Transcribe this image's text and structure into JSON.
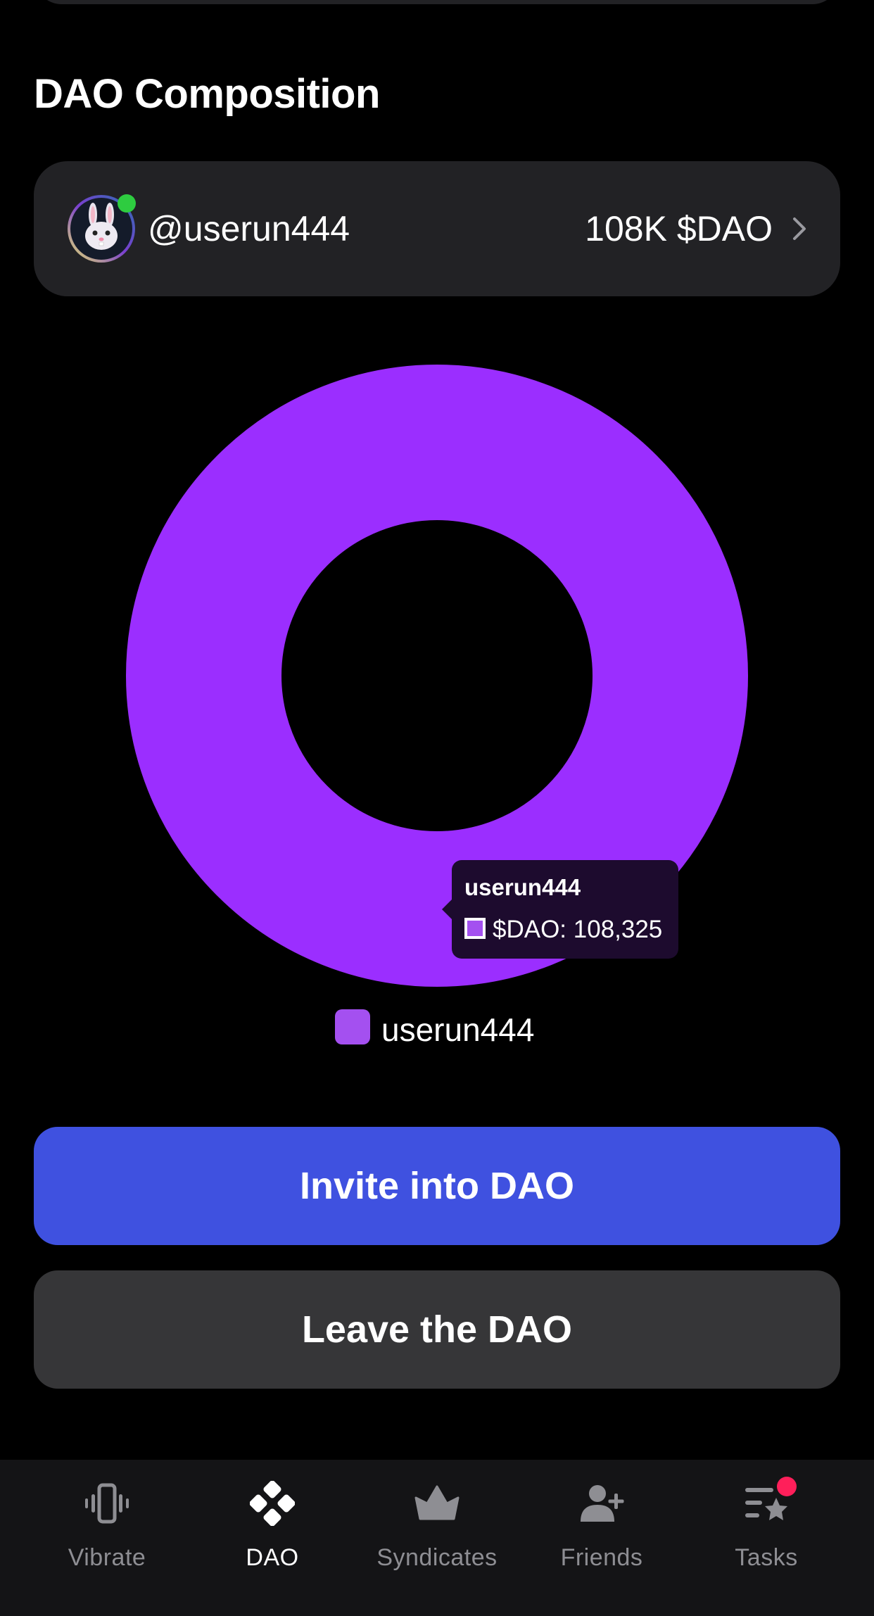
{
  "section_title": "DAO Composition",
  "member": {
    "username": "@userun444",
    "amount": "108K $DAO",
    "online": true,
    "avatar_icon": "bunny-face-icon"
  },
  "chart_data": {
    "type": "pie",
    "donut": true,
    "title": "",
    "series": [
      {
        "name": "userun444",
        "label": "$DAO",
        "value": 108325,
        "color": "#9b2eff"
      }
    ],
    "legend": {
      "placement": "bottom-center",
      "entries": [
        "userun444"
      ],
      "swatch_color": "#a450f0"
    },
    "tooltip": {
      "title": "userun444",
      "text": "$DAO: 108,325"
    }
  },
  "buttons": {
    "invite_label": "Invite into DAO",
    "leave_label": "Leave the DAO",
    "invite_color": "#3f51e0",
    "leave_color": "#363638"
  },
  "tabbar": {
    "active": "DAO",
    "tabs": [
      {
        "label": "Vibrate",
        "icon": "vibrate-phone-icon"
      },
      {
        "label": "DAO",
        "icon": "dao-diamond-icon"
      },
      {
        "label": "Syndicates",
        "icon": "crown-icon"
      },
      {
        "label": "Friends",
        "icon": "add-person-icon"
      },
      {
        "label": "Tasks",
        "icon": "tasks-star-icon",
        "badge": true
      }
    ],
    "badge_color": "#ff1f5a"
  }
}
